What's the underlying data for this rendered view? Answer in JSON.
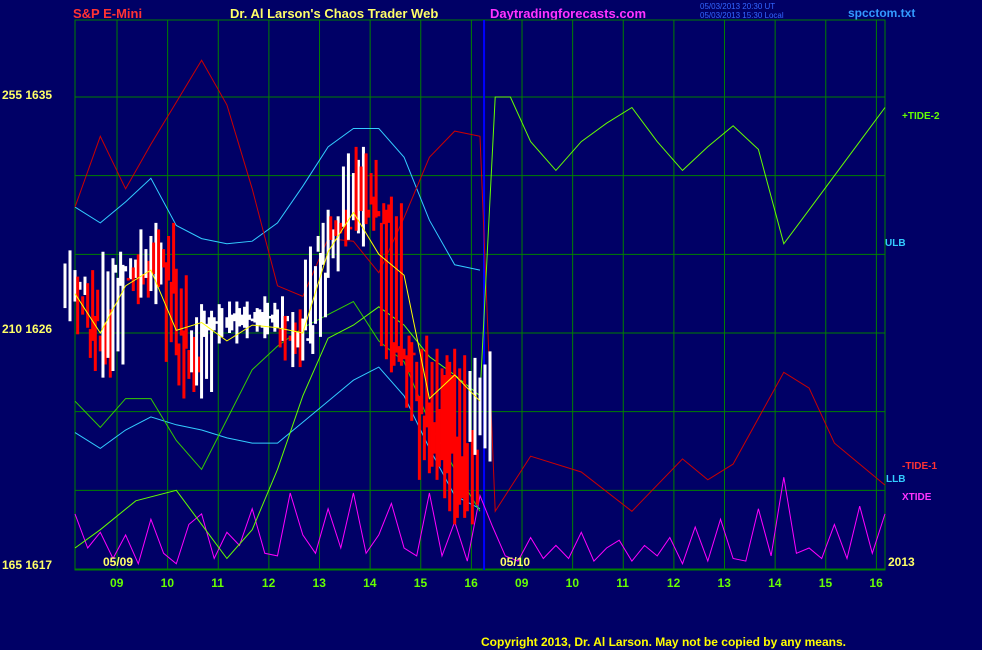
{
  "header": {
    "symbol": "S&P E-Mini",
    "title": "Dr. Al Larson's Chaos Trader Web",
    "site": "Daytradingforecasts.com",
    "time_ut": "05/03/2013 20:30 UT",
    "time_local": "05/03/2013 15:30 Local",
    "file": "spcctom.txt"
  },
  "footer": {
    "copyright": "Copyright 2013, Dr. Al Larson. May not be copied by any means."
  },
  "colors": {
    "background": "#000066",
    "grid": "#008000",
    "divider": "#0000ff",
    "tide2": "#66ff00",
    "tide1": "#cc0000",
    "band": "#33ccff",
    "xtide": "#ff00ff",
    "avg": "#ffff00",
    "bar_up": "#ffffff",
    "bar_down": "#ff0000",
    "green_line": "#33cc00"
  },
  "chart_data": {
    "type": "line",
    "y_left_labels": [
      {
        "text": "255 1635",
        "price": 1635
      },
      {
        "text": "210 1626",
        "price": 1626
      },
      {
        "text": "165 1617",
        "price": 1617
      }
    ],
    "x_ticks": [
      "09",
      "10",
      "11",
      "12",
      "13",
      "14",
      "15",
      "16",
      "09",
      "10",
      "11",
      "12",
      "13",
      "14",
      "15",
      "16"
    ],
    "date_labels": [
      "05/09",
      "05/10"
    ],
    "year_label": "2013",
    "series_labels": [
      {
        "text": "+TIDE-2",
        "color": "#66ff00"
      },
      {
        "text": "ULB",
        "color": "#33ccff"
      },
      {
        "text": "-TIDE-1",
        "color": "#ff3333"
      },
      {
        "text": "LLB",
        "color": "#33ccff"
      },
      {
        "text": "XTIDE",
        "color": "#ff00ff"
      }
    ],
    "hour_index_note": "x values are hour positions 0..16 (0=08h day1, 8=16h day1 / divider, 16=16h day2)",
    "tide2": {
      "x": [
        0,
        0.5,
        1.2,
        2,
        2.5,
        3,
        3.5,
        4,
        4.5,
        5,
        5.5,
        6,
        6.5,
        7,
        7.5,
        8,
        8.3,
        8.6,
        9,
        9.5,
        10,
        10.5,
        11,
        11.5,
        12,
        12.5,
        13,
        13.5,
        14,
        14.5,
        15,
        15.5,
        16
      ],
      "y": [
        1617.8,
        1618.5,
        1619.6,
        1620,
        1618.7,
        1617.4,
        1618.5,
        1620.8,
        1623.6,
        1625.8,
        1626.3,
        1627,
        1626.3,
        1625.1,
        1624.4,
        1623.6,
        1635,
        1635,
        1633.3,
        1632.2,
        1633.3,
        1634,
        1634.6,
        1633.3,
        1632.2,
        1633.1,
        1633.9,
        1633,
        1629.4,
        1630.7,
        1632,
        1633.3,
        1634.6
      ]
    },
    "tide1": {
      "x": [
        0,
        0.5,
        1,
        1.5,
        2,
        2.5,
        3,
        3.5,
        4,
        4.5,
        5,
        5.5,
        6,
        6.5,
        7,
        7.5,
        8,
        8.3,
        9,
        10,
        11,
        12,
        12.5,
        13,
        14,
        14.5,
        15,
        15.5,
        16
      ],
      "y": [
        1630.8,
        1633.5,
        1631.5,
        1633.2,
        1634.8,
        1636.4,
        1634.7,
        1631.5,
        1627.8,
        1627.4,
        1629.6,
        1629.5,
        1628.3,
        1630.4,
        1632.7,
        1633.7,
        1633.5,
        1619.2,
        1621.3,
        1620.7,
        1619.2,
        1621.2,
        1620.4,
        1621,
        1624.5,
        1623.9,
        1621.8,
        1621,
        1620.2
      ]
    },
    "ulb": {
      "x": [
        0,
        0.5,
        1,
        1.5,
        2,
        2.5,
        3,
        3.5,
        4,
        4.5,
        5,
        5.5,
        6,
        6.5,
        7,
        7.5,
        8
      ],
      "y": [
        1630.8,
        1630.2,
        1631,
        1631.9,
        1630.1,
        1629.6,
        1629.4,
        1629.5,
        1630.2,
        1631.6,
        1633.1,
        1633.8,
        1633.8,
        1632.7,
        1630.3,
        1628.6,
        1628.4
      ]
    },
    "llb": {
      "x": [
        0,
        0.5,
        1,
        1.5,
        2,
        2.5,
        3,
        3.5,
        4,
        4.5,
        5,
        5.5,
        6,
        6.5,
        7,
        7.5,
        8
      ],
      "y": [
        1622.2,
        1621.6,
        1622.3,
        1622.8,
        1622.5,
        1622.3,
        1622,
        1621.8,
        1621.8,
        1622.6,
        1623.4,
        1624.2,
        1624.7,
        1623.6,
        1621.6,
        1619.8,
        1619.3
      ]
    },
    "green2": {
      "x": [
        0,
        0.5,
        1,
        1.5,
        2,
        2.5,
        3,
        3.5,
        4,
        4.5,
        5,
        5.5,
        6,
        6.5,
        7,
        7.5,
        8
      ],
      "y": [
        1623.4,
        1622.4,
        1623.5,
        1623.5,
        1621.9,
        1620.8,
        1622.7,
        1624.6,
        1625.5,
        1626.2,
        1626.7,
        1627.2,
        1625.7,
        1624.9,
        1622.6,
        1620.8,
        1619.2
      ]
    },
    "xtide": {
      "x": [
        0,
        0.25,
        0.5,
        0.75,
        1,
        1.25,
        1.5,
        1.75,
        2,
        2.25,
        2.5,
        2.75,
        3,
        3.25,
        3.5,
        3.75,
        4,
        4.25,
        4.5,
        4.75,
        5,
        5.25,
        5.5,
        5.75,
        6,
        6.25,
        6.5,
        6.75,
        7,
        7.25,
        7.5,
        7.75,
        8,
        8.25,
        8.5,
        8.75,
        9,
        9.25,
        9.5,
        9.75,
        10,
        10.25,
        10.5,
        10.75,
        11,
        11.25,
        11.5,
        11.75,
        12,
        12.25,
        12.5,
        12.75,
        13,
        13.25,
        13.5,
        13.75,
        14,
        14.25,
        14.5,
        14.75,
        15,
        15.25,
        15.5,
        15.75,
        16
      ],
      "y": [
        1619.1,
        1617.8,
        1618.4,
        1617.4,
        1618.3,
        1617.2,
        1618.9,
        1617.6,
        1617.2,
        1618.7,
        1619.1,
        1617.4,
        1618.4,
        1617.9,
        1619.3,
        1617.6,
        1617.5,
        1619.9,
        1618.3,
        1617.6,
        1619.3,
        1617.8,
        1619.9,
        1617.6,
        1618.3,
        1619.5,
        1617.8,
        1617.5,
        1619.9,
        1617.5,
        1618.8,
        1617.3,
        1619.8,
        1618.6,
        1617.5,
        1617.3,
        1618.2,
        1617.4,
        1617.9,
        1617.4,
        1618.4,
        1617.3,
        1617.8,
        1618.1,
        1617.3,
        1617.9,
        1617.5,
        1618.2,
        1617.2,
        1618.6,
        1617.3,
        1618.9,
        1617.4,
        1617.3,
        1619.3,
        1617.5,
        1620.5,
        1617.6,
        1617.8,
        1617.4,
        1618.7,
        1617.4,
        1619.4,
        1617.6,
        1619.1
      ]
    },
    "price_avg": {
      "x": [
        0,
        0.5,
        1,
        1.5,
        2,
        2.5,
        3,
        3.5,
        4,
        4.5,
        5,
        5.5,
        6,
        6.5,
        7,
        7.5,
        8
      ],
      "y": [
        1627.5,
        1626,
        1627.8,
        1628.4,
        1626.1,
        1626.4,
        1625.7,
        1626.3,
        1626.2,
        1626,
        1629.1,
        1630.6,
        1629,
        1628.2,
        1623.5,
        1624.4,
        1623.4
      ]
    },
    "price": {
      "x": [
        0,
        0.25,
        0.5,
        0.75,
        1,
        1.25,
        1.5,
        1.75,
        2,
        2.25,
        2.5,
        2.75,
        3,
        3.25,
        3.5,
        3.75,
        4,
        4.25,
        4.5,
        4.75,
        5,
        5.25,
        5.5,
        5.75,
        6,
        6.25,
        6.5,
        6.75,
        7,
        7.25,
        7.5,
        7.75,
        8
      ],
      "y": [
        1627.8,
        1626.3,
        1624.9,
        1628.5,
        1628.4,
        1627.7,
        1629.6,
        1628.1,
        1625.5,
        1624.1,
        1626.5,
        1626.2,
        1626.6,
        1626.6,
        1626.4,
        1626.8,
        1626.3,
        1625.3,
        1626.2,
        1628.7,
        1630.1,
        1629.9,
        1632.5,
        1630.5,
        1630.6,
        1625.1,
        1625.3,
        1623,
        1621,
        1624.8,
        1619.3,
        1621.7,
        1624.7
      ],
      "direction": [
        1,
        -1,
        -1,
        1,
        1,
        -1,
        1,
        -1,
        -1,
        -1,
        1,
        1,
        1,
        1,
        1,
        1,
        1,
        -1,
        1,
        1,
        1,
        -1,
        1,
        -1,
        -1,
        -1,
        -1,
        -1,
        -1,
        -1,
        -1,
        -1,
        1
      ]
    }
  }
}
